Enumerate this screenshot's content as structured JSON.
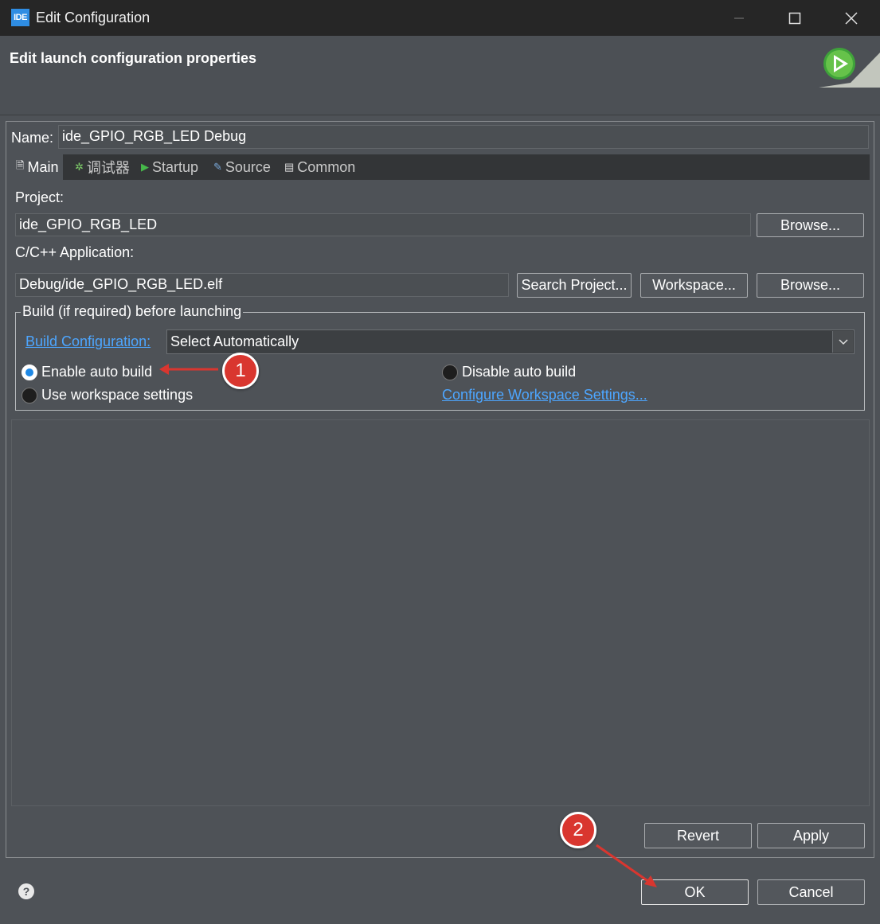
{
  "window": {
    "app_icon": "IDE",
    "title": "Edit Configuration",
    "controls": [
      "minimize-icon",
      "maximize-icon",
      "close-icon"
    ]
  },
  "header": {
    "title": "Edit launch configuration properties",
    "graphic": "launch-run-icon"
  },
  "name": {
    "label": "Name:",
    "value": "ide_GPIO_RGB_LED Debug"
  },
  "tabs": [
    {
      "label": "Main",
      "icon": "document-icon",
      "active": true
    },
    {
      "label": "调试器",
      "icon": "debugger-bug-icon",
      "active": false
    },
    {
      "label": "Startup",
      "icon": "play-icon",
      "active": false
    },
    {
      "label": "Source",
      "icon": "source-icon",
      "active": false
    },
    {
      "label": "Common",
      "icon": "common-icon",
      "active": false
    }
  ],
  "main": {
    "project_label": "Project:",
    "project_value": "ide_GPIO_RGB_LED",
    "project_browse": "Browse...",
    "app_label": "C/C++ Application:",
    "app_value": "Debug/ide_GPIO_RGB_LED.elf",
    "search_project": "Search Project...",
    "workspace": "Workspace...",
    "app_browse": "Browse..."
  },
  "build_group": {
    "legend": "Build (if required) before launching",
    "build_config_link": "Build Configuration:",
    "build_config_value": "Select Automatically",
    "enable_auto_build": "Enable auto build",
    "disable_auto_build": "Disable auto build",
    "use_workspace": "Use workspace settings",
    "configure_link": "Configure Workspace Settings...",
    "selected": "enable_auto_build"
  },
  "actions": {
    "revert": "Revert",
    "apply": "Apply",
    "ok": "OK",
    "cancel": "Cancel"
  },
  "annotations": {
    "badge1": "1",
    "badge2": "2",
    "color": "#d9362f"
  },
  "colors": {
    "background": "#4e5257",
    "titlebar": "#262626",
    "link": "#4da6ff",
    "selected_radio": "#1e88e5"
  }
}
